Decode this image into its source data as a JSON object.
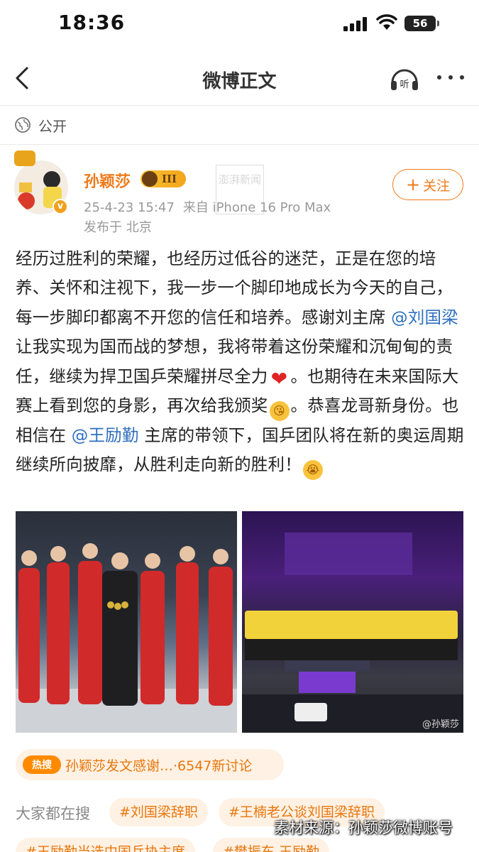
{
  "status_bar": {
    "time": "18:36",
    "battery": "56"
  },
  "nav": {
    "title": "微博正文",
    "icons": [
      "back-icon",
      "listen-icon",
      "more-icon"
    ]
  },
  "visibility": {
    "label": "公开"
  },
  "author": {
    "name": "孙颖莎",
    "level": "III",
    "date": "25-4-23 15:47",
    "source": "来自 iPhone 16 Pro Max",
    "location": "发布于 北京",
    "follow_label": "关注"
  },
  "post": {
    "p1": "经历过胜利的荣耀，也经历过低谷的迷茫，正是在您的培养、关怀和注视下，我一步一个脚印地成长为今天的自己，每一步脚印都离不开您的信任和培养。感谢刘主席 ",
    "mention1": "@刘国梁",
    "p2": " 让我实现为国而战的梦想，我将带着这份荣耀和沉甸甸的责任，继续为捍卫国乒荣耀拼尽全力",
    "p3": "。也期待在未来国际大赛上看到您的身影，再次给我颁奖",
    "p4": "。恭喜龙哥新身份。也相信在 ",
    "mention2": "@王励勤",
    "p5": " 主席的带领下，国乒团队将在新的奥运周期继续所向披靡，从胜利走向新的胜利！",
    "emoji_heart": "❤",
    "emoji_face": "😘",
    "emoji_face2": "😭"
  },
  "photos": {
    "watermark": "@孙颖莎"
  },
  "hot": {
    "badge": "热搜",
    "text": "孙颖莎发文感谢…·6547新讨论"
  },
  "search": {
    "label": "大家都在搜",
    "chips": [
      "#刘国梁辞职",
      "#王楠老公谈刘国梁辞职",
      "#王励勤当选中国乒协主席",
      "#樊振东 王励勤"
    ]
  },
  "source_note": "素材来源：孙颖莎微博账号",
  "news_watermark": "澎湃新闻"
}
